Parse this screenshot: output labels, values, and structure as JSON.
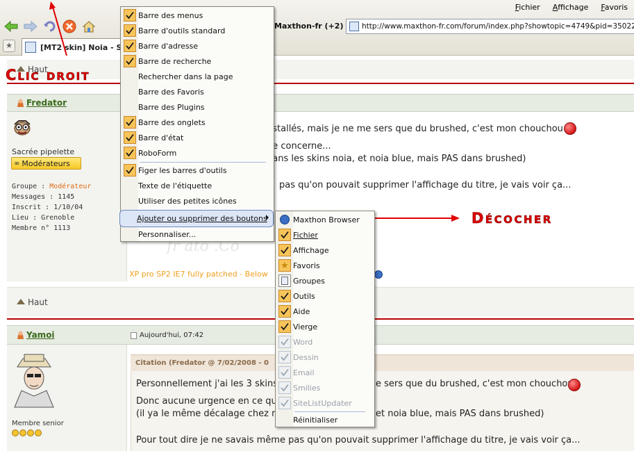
{
  "browser": {
    "menu": [
      "Fichier",
      "Affichage",
      "Favoris"
    ],
    "addr_label": "Maxthon-fr (+2)",
    "url": "http://www.maxthon-fr.com/forum/index.php?showtopic=4749&pid=35022&st=2",
    "tab_title": "[MT2 skin] Noia - Sup"
  },
  "annotations": {
    "clic_droit": "Clic droit",
    "decocher": "Décocher"
  },
  "post1": {
    "haut_top": "Haut",
    "username": "Fredator",
    "rank": "Sacrée pipelette",
    "badge": "Modérateurs",
    "groupe_label": "Groupe : ",
    "groupe_val": "Modérateur",
    "messages": "Messages : 1145",
    "inscrit": "Inscrit : 1/10/04",
    "lieu": "Lieu : Grenoble",
    "membre": "Membre n° 1113",
    "line1": "nstallés, mais je ne me sers que du brushed, c'est mon chouchou",
    "line2": "ne concerne...",
    "line3": "dans les skins noia, et noia blue, mais PAS dans brushed)",
    "line4": "pas qu'on pouvait supprimer l'affichage du titre, je vais voir ça...",
    "signature": "XP pro SP2 IE7 fully patched - Below",
    "haut_bottom": "Haut"
  },
  "post2": {
    "username": "Yamoi",
    "date": "Aujourd'hui, 07:42",
    "rank": "Membre senior",
    "quote_header": "Citation (Fredator @ 7/02/2008 - 0",
    "q1": "Personnellement j'ai les 3 skins",
    "q1b": "e sers que du brushed, c'est mon chouchou",
    "q2": "Donc aucune urgence en ce qui",
    "q3": "(il ya le même décalage chez mo",
    "q3b": "et noia blue, mais PAS dans brushed)",
    "q4": "Pour tout dire je ne savais même pas qu'on pouvait supprimer l'affichage du titre, je vais voir ça..."
  },
  "context_menu": {
    "items": [
      {
        "label": "Barre des menus",
        "checked": true
      },
      {
        "label": "Barre d'outils standard",
        "checked": true
      },
      {
        "label": "Barre d'adresse",
        "checked": true
      },
      {
        "label": "Barre de recherche",
        "checked": true
      },
      {
        "label": "Rechercher dans la page",
        "checked": false
      },
      {
        "label": "Barre des Favoris",
        "checked": false
      },
      {
        "label": "Barre des Plugins",
        "checked": false
      },
      {
        "label": "Barre des onglets",
        "checked": true
      },
      {
        "label": "Barre d'état",
        "checked": true
      },
      {
        "label": "RoboForm",
        "checked": true
      },
      {
        "label": "Figer les barres d'outils",
        "checked": true
      },
      {
        "label": "Texte de l'étiquette",
        "checked": false
      },
      {
        "label": "Utiliser des petites icônes",
        "checked": false
      },
      {
        "label": "Ajouter ou supprimer des boutons",
        "checked": false
      },
      {
        "label": "Personnaliser...",
        "checked": false
      }
    ]
  },
  "submenu": {
    "items": [
      {
        "label": "Maxthon Browser",
        "state": "icon"
      },
      {
        "label": "Fichier",
        "state": "checked"
      },
      {
        "label": "Affichage",
        "state": "checked"
      },
      {
        "label": "Favoris",
        "state": "icon"
      },
      {
        "label": "Groupes",
        "state": "icon"
      },
      {
        "label": "Outils",
        "state": "checked"
      },
      {
        "label": "Aide",
        "state": "checked"
      },
      {
        "label": "Vierge",
        "state": "checked"
      },
      {
        "label": "Word",
        "state": "disabled"
      },
      {
        "label": "Dessin",
        "state": "disabled"
      },
      {
        "label": "Email",
        "state": "disabled"
      },
      {
        "label": "Smilies",
        "state": "disabled"
      },
      {
        "label": "SiteListUpdater",
        "state": "disabled"
      },
      {
        "label": "Réinitialiser",
        "state": "none"
      }
    ]
  },
  "colors": {
    "annotation": "#e00000",
    "checkbox": "#f7c45a",
    "username": "#3a6a1a",
    "group": "#e06a16"
  }
}
